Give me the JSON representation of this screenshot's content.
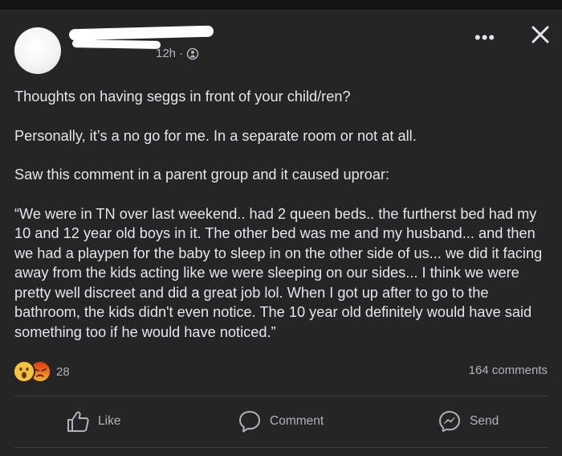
{
  "post": {
    "time": "12h",
    "separator": "·",
    "more_label": "•••",
    "paragraphs": [
      "Thoughts on having seggs in front of your child/ren?",
      "Personally, it’s a no go for me. In a separate room or not at all.",
      "Saw this comment in a parent group and it caused uproar:"
    ],
    "quote": "“We were in TN over last weekend.. had 2 queen beds.. the furtherst bed had my 10 and 12 year old boys in it. The other bed was me and my husband... and then we had a playpen for the baby to sleep in on the other side of us... we did it facing away from the kids acting like we were sleeping on our sides... I think we were pretty well discreet and did a great job lol. When I got up after to go to the bathroom, the kids didn't even notice. The 10 year old definitely would have said something too if he would have noticed.”"
  },
  "reactions": {
    "count": "28",
    "types": [
      "wow",
      "angry"
    ]
  },
  "comments_count": "164 comments",
  "actions": {
    "like": "Like",
    "comment": "Comment",
    "send": "Send"
  },
  "colors": {
    "background": "#252526",
    "text": "#e4e6eb",
    "secondary_text": "#b0b3b8",
    "divider": "#3a3b3c"
  }
}
